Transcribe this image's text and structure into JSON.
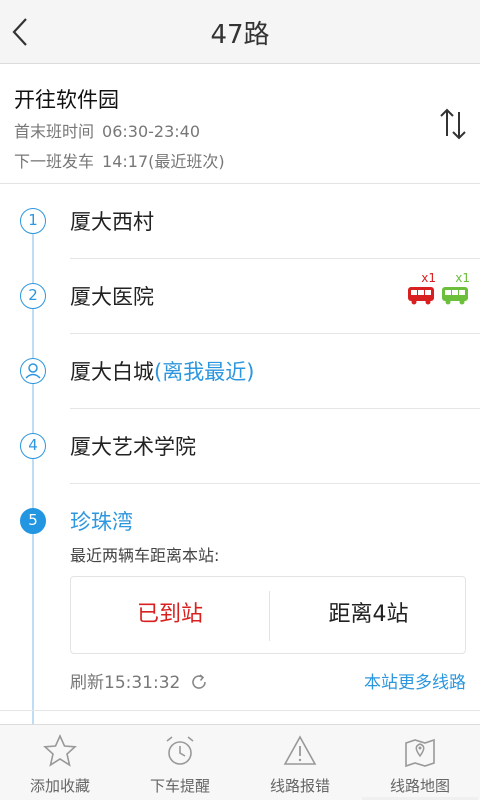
{
  "header": {
    "title": "47路"
  },
  "route": {
    "direction": "开往软件园",
    "first_last_label": "首末班时间",
    "first_last_value": "06:30-23:40",
    "next_label": "下一班发车",
    "next_value": "14:17(最近班次)"
  },
  "stops": [
    {
      "index": "1",
      "name": "厦大西村"
    },
    {
      "index": "2",
      "name": "厦大医院",
      "buses": [
        {
          "count": "x1",
          "color": "#d92020"
        },
        {
          "count": "x1",
          "color": "#6bbf3b"
        }
      ]
    },
    {
      "index": "",
      "name": "厦大白城",
      "note": "(离我最近)"
    },
    {
      "index": "4",
      "name": "厦大艺术学院"
    },
    {
      "index": "5",
      "name": "珍珠湾"
    }
  ],
  "active_stop": {
    "subtitle": "最近两辆车距离本站:",
    "eta_first": "已到站",
    "eta_second": "距离4站",
    "refresh": "刷新15:31:32",
    "more_lines": "本站更多线路"
  },
  "tabs": [
    {
      "label": "添加收藏",
      "icon": "star-icon"
    },
    {
      "label": "下车提醒",
      "icon": "alarm-clock-icon"
    },
    {
      "label": "线路报错",
      "icon": "warning-icon"
    },
    {
      "label": "线路地图",
      "icon": "map-pin-icon"
    }
  ],
  "colors": {
    "accent": "#2c97de",
    "arrived": "#d92020",
    "bus_red": "#d92020",
    "bus_green": "#6bbf3b"
  }
}
